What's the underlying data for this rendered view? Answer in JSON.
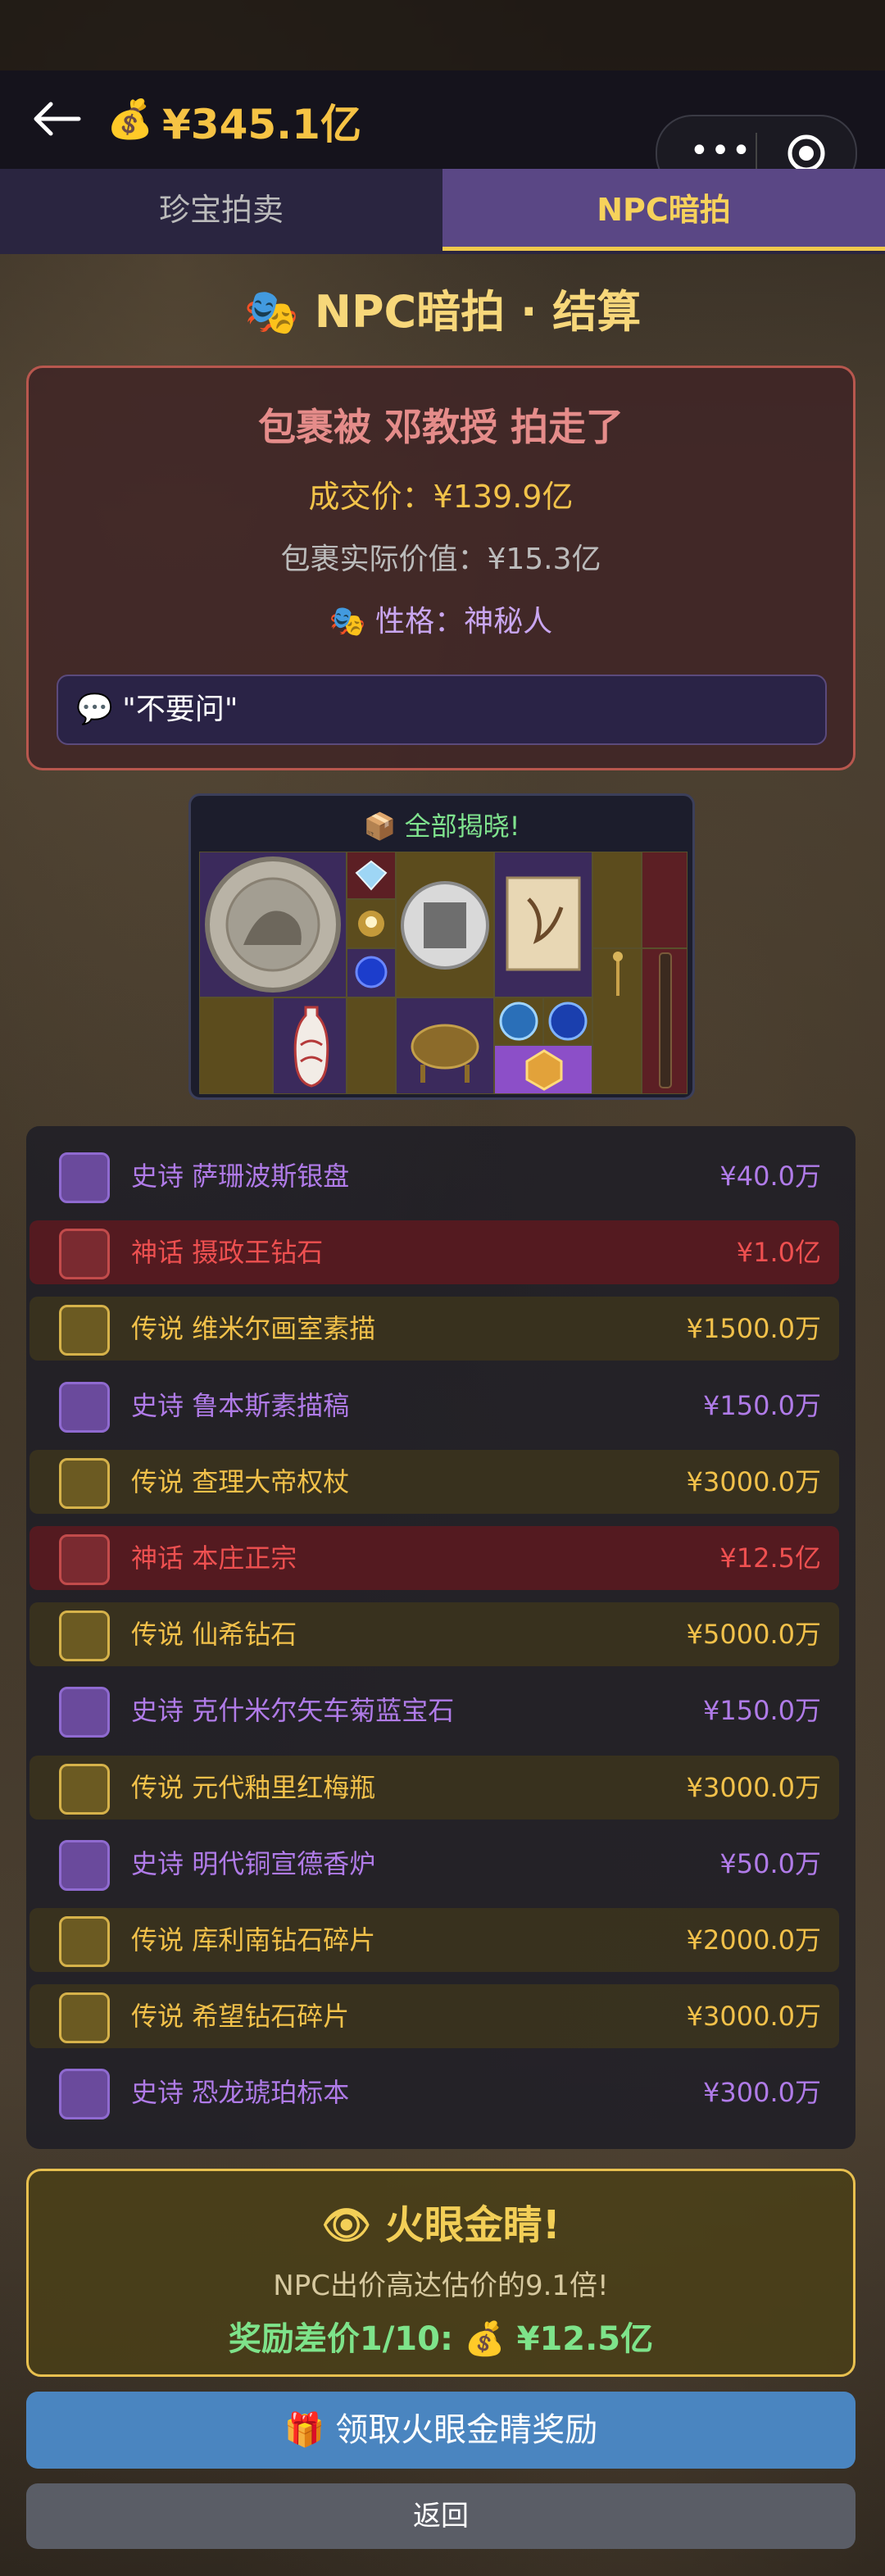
{
  "header": {
    "back_icon": "arrow-left-icon",
    "money_icon": "money-bag-icon",
    "money": "¥345.1亿",
    "capsule_more": "•••"
  },
  "tabs": [
    {
      "label": "珍宝拍卖",
      "active": false
    },
    {
      "label": "NPC暗拍",
      "active": true
    }
  ],
  "heading": "NPC暗拍 · 结算",
  "result": {
    "title": "包裹被 邓教授 拍走了",
    "deal_price": "成交价：¥139.9亿",
    "actual_value": "包裹实际价值：¥15.3亿",
    "personality": "性格：神秘人",
    "quote": "\"不要问\""
  },
  "reveal": {
    "title": "全部揭晓!"
  },
  "items": [
    {
      "rarity": "史诗",
      "name": "萨珊波斯银盘",
      "price": "¥40.0万",
      "tier": "epic"
    },
    {
      "rarity": "神话",
      "name": "摄政王钻石",
      "price": "¥1.0亿",
      "tier": "myth"
    },
    {
      "rarity": "传说",
      "name": "维米尔画室素描",
      "price": "¥1500.0万",
      "tier": "legend"
    },
    {
      "rarity": "史诗",
      "name": "鲁本斯素描稿",
      "price": "¥150.0万",
      "tier": "epic"
    },
    {
      "rarity": "传说",
      "name": "查理大帝权杖",
      "price": "¥3000.0万",
      "tier": "legend"
    },
    {
      "rarity": "神话",
      "name": "本庄正宗",
      "price": "¥12.5亿",
      "tier": "myth"
    },
    {
      "rarity": "传说",
      "name": "仙希钻石",
      "price": "¥5000.0万",
      "tier": "legend"
    },
    {
      "rarity": "史诗",
      "name": "克什米尔矢车菊蓝宝石",
      "price": "¥150.0万",
      "tier": "epic"
    },
    {
      "rarity": "传说",
      "name": "元代釉里红梅瓶",
      "price": "¥3000.0万",
      "tier": "legend"
    },
    {
      "rarity": "史诗",
      "name": "明代铜宣德香炉",
      "price": "¥50.0万",
      "tier": "epic"
    },
    {
      "rarity": "传说",
      "name": "库利南钻石碎片",
      "price": "¥2000.0万",
      "tier": "legend"
    },
    {
      "rarity": "传说",
      "name": "希望钻石碎片",
      "price": "¥3000.0万",
      "tier": "legend"
    },
    {
      "rarity": "史诗",
      "name": "恐龙琥珀标本",
      "price": "¥300.0万",
      "tier": "epic"
    }
  ],
  "reward": {
    "title": "火眼金睛!",
    "subtitle": "NPC出价高达估价的9.1倍!",
    "bonus": "奖励差价1/10: 💰 ¥12.5亿"
  },
  "buttons": {
    "claim": "领取火眼金睛奖励",
    "return": "返回"
  },
  "colors": {
    "epic": "#b07be8",
    "myth": "#ee5050",
    "legend": "#f2c14a",
    "money": "#f6c344"
  }
}
